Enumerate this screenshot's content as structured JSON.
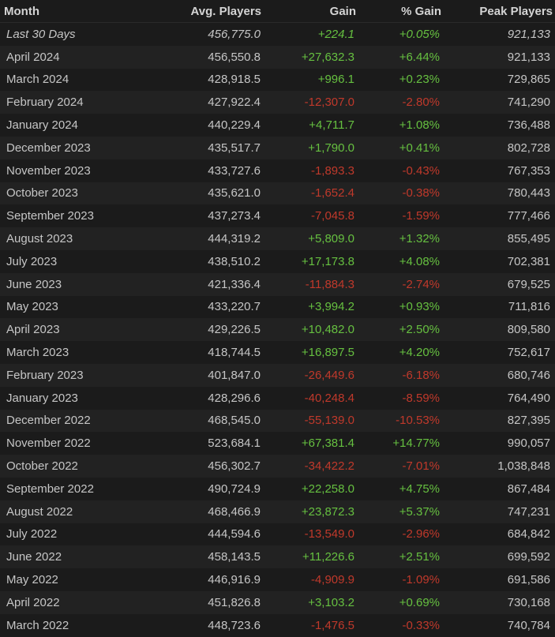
{
  "colors": {
    "background": "#1b1b1b",
    "row_alt": "#222222",
    "text": "#c6c6c6",
    "positive": "#66c040",
    "negative": "#c0392b"
  },
  "headers": {
    "month": "Month",
    "avg": "Avg. Players",
    "gain": "Gain",
    "pct": "% Gain",
    "peak": "Peak Players"
  },
  "rows": [
    {
      "month": "Last 30 Days",
      "avg": "456,775.0",
      "gain": "+224.1",
      "pct": "+0.05%",
      "peak": "921,133"
    },
    {
      "month": "April 2024",
      "avg": "456,550.8",
      "gain": "+27,632.3",
      "pct": "+6.44%",
      "peak": "921,133"
    },
    {
      "month": "March 2024",
      "avg": "428,918.5",
      "gain": "+996.1",
      "pct": "+0.23%",
      "peak": "729,865"
    },
    {
      "month": "February 2024",
      "avg": "427,922.4",
      "gain": "-12,307.0",
      "pct": "-2.80%",
      "peak": "741,290"
    },
    {
      "month": "January 2024",
      "avg": "440,229.4",
      "gain": "+4,711.7",
      "pct": "+1.08%",
      "peak": "736,488"
    },
    {
      "month": "December 2023",
      "avg": "435,517.7",
      "gain": "+1,790.0",
      "pct": "+0.41%",
      "peak": "802,728"
    },
    {
      "month": "November 2023",
      "avg": "433,727.6",
      "gain": "-1,893.3",
      "pct": "-0.43%",
      "peak": "767,353"
    },
    {
      "month": "October 2023",
      "avg": "435,621.0",
      "gain": "-1,652.4",
      "pct": "-0.38%",
      "peak": "780,443"
    },
    {
      "month": "September 2023",
      "avg": "437,273.4",
      "gain": "-7,045.8",
      "pct": "-1.59%",
      "peak": "777,466"
    },
    {
      "month": "August 2023",
      "avg": "444,319.2",
      "gain": "+5,809.0",
      "pct": "+1.32%",
      "peak": "855,495"
    },
    {
      "month": "July 2023",
      "avg": "438,510.2",
      "gain": "+17,173.8",
      "pct": "+4.08%",
      "peak": "702,381"
    },
    {
      "month": "June 2023",
      "avg": "421,336.4",
      "gain": "-11,884.3",
      "pct": "-2.74%",
      "peak": "679,525"
    },
    {
      "month": "May 2023",
      "avg": "433,220.7",
      "gain": "+3,994.2",
      "pct": "+0.93%",
      "peak": "711,816"
    },
    {
      "month": "April 2023",
      "avg": "429,226.5",
      "gain": "+10,482.0",
      "pct": "+2.50%",
      "peak": "809,580"
    },
    {
      "month": "March 2023",
      "avg": "418,744.5",
      "gain": "+16,897.5",
      "pct": "+4.20%",
      "peak": "752,617"
    },
    {
      "month": "February 2023",
      "avg": "401,847.0",
      "gain": "-26,449.6",
      "pct": "-6.18%",
      "peak": "680,746"
    },
    {
      "month": "January 2023",
      "avg": "428,296.6",
      "gain": "-40,248.4",
      "pct": "-8.59%",
      "peak": "764,490"
    },
    {
      "month": "December 2022",
      "avg": "468,545.0",
      "gain": "-55,139.0",
      "pct": "-10.53%",
      "peak": "827,395"
    },
    {
      "month": "November 2022",
      "avg": "523,684.1",
      "gain": "+67,381.4",
      "pct": "+14.77%",
      "peak": "990,057"
    },
    {
      "month": "October 2022",
      "avg": "456,302.7",
      "gain": "-34,422.2",
      "pct": "-7.01%",
      "peak": "1,038,848"
    },
    {
      "month": "September 2022",
      "avg": "490,724.9",
      "gain": "+22,258.0",
      "pct": "+4.75%",
      "peak": "867,484"
    },
    {
      "month": "August 2022",
      "avg": "468,466.9",
      "gain": "+23,872.3",
      "pct": "+5.37%",
      "peak": "747,231"
    },
    {
      "month": "July 2022",
      "avg": "444,594.6",
      "gain": "-13,549.0",
      "pct": "-2.96%",
      "peak": "684,842"
    },
    {
      "month": "June 2022",
      "avg": "458,143.5",
      "gain": "+11,226.6",
      "pct": "+2.51%",
      "peak": "699,592"
    },
    {
      "month": "May 2022",
      "avg": "446,916.9",
      "gain": "-4,909.9",
      "pct": "-1.09%",
      "peak": "691,586"
    },
    {
      "month": "April 2022",
      "avg": "451,826.8",
      "gain": "+3,103.2",
      "pct": "+0.69%",
      "peak": "730,168"
    },
    {
      "month": "March 2022",
      "avg": "448,723.6",
      "gain": "-1,476.5",
      "pct": "-0.33%",
      "peak": "740,784"
    }
  ]
}
